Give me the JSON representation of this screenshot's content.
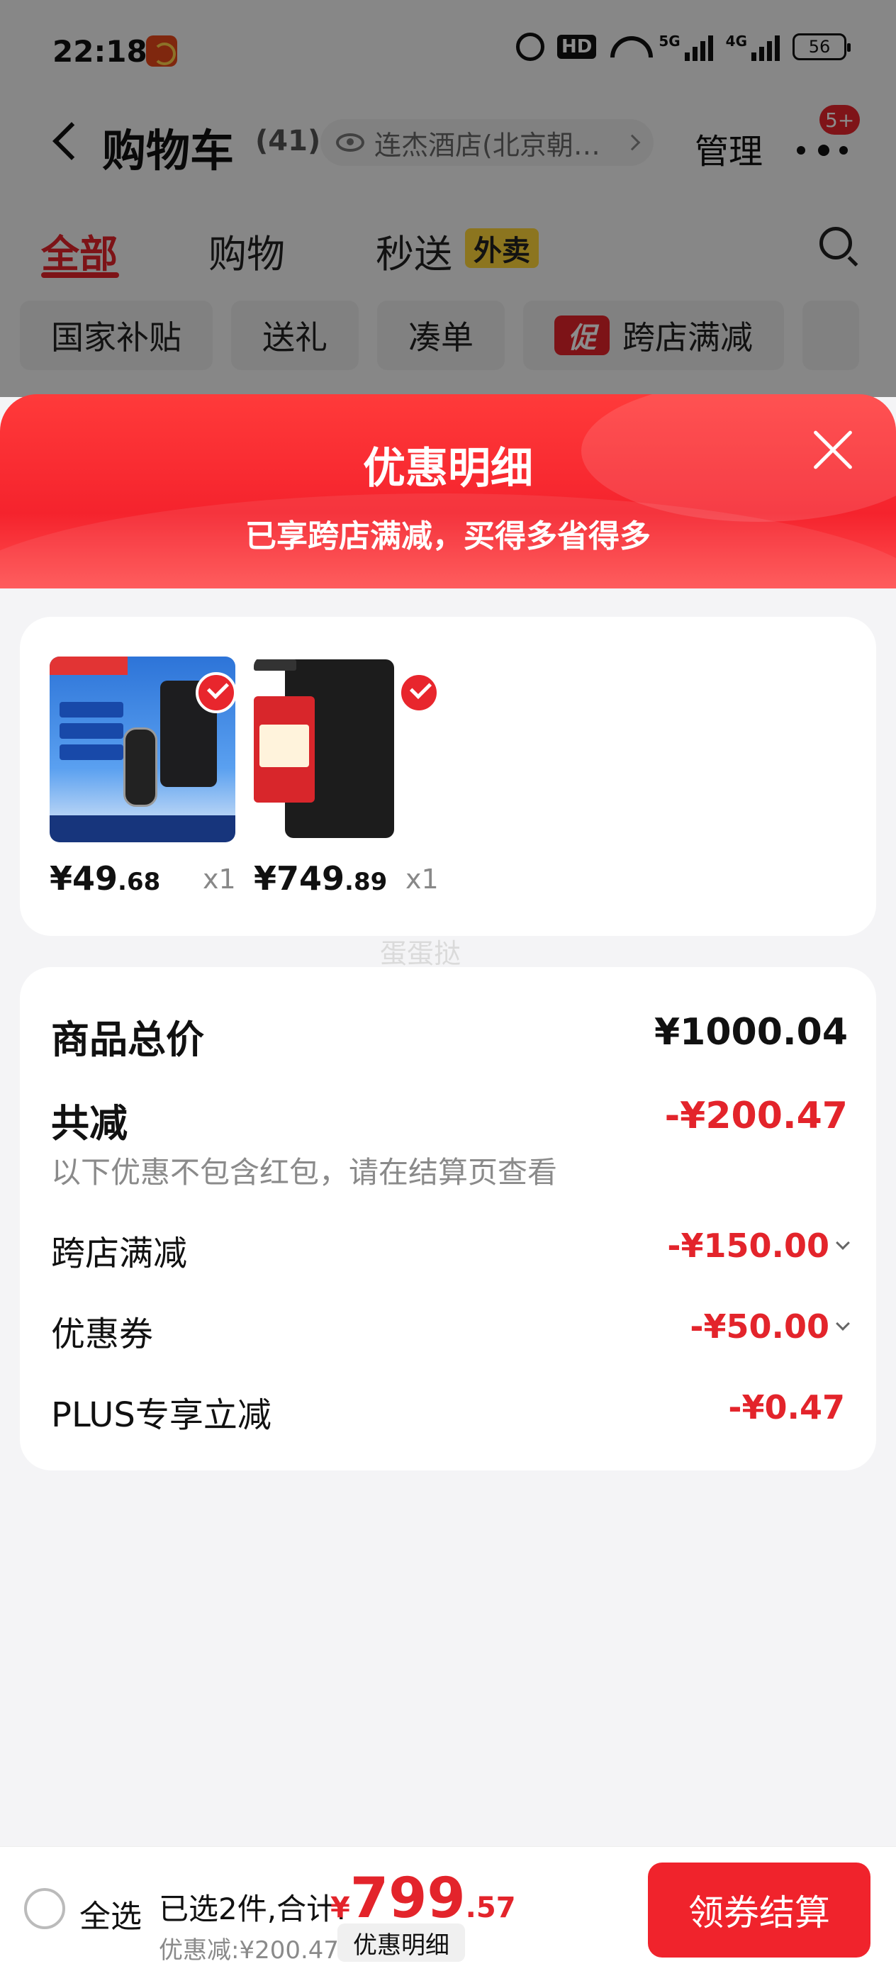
{
  "status_bar": {
    "time": "22:18",
    "hd": "HD",
    "net1": "5G",
    "net2": "4G",
    "battery": "56"
  },
  "nav": {
    "title": "购物车",
    "count": "(41)",
    "address": "连杰酒店(北京朝…",
    "manage_label": "管理",
    "badge": "5+"
  },
  "tabs": [
    {
      "label": "全部",
      "active": true
    },
    {
      "label": "购物",
      "active": false
    },
    {
      "label": "秒送",
      "active": false
    }
  ],
  "takeout_badge": "外卖",
  "chips": [
    {
      "label": "国家补贴"
    },
    {
      "label": "送礼"
    },
    {
      "label": "凑单"
    },
    {
      "label": "跨店满减",
      "tag": "促"
    }
  ],
  "sheet": {
    "title": "优惠明细",
    "subtitle": "已享跨店满减，买得多省得多"
  },
  "products": [
    {
      "price_int": "¥49",
      "price_dec": ".68",
      "qty": "x1",
      "image_icon": "door-alarm-icon",
      "checked": true
    },
    {
      "price_int": "¥749",
      "price_dec": ".89",
      "qty": "x1",
      "image_icon": "hard-drive-icon",
      "checked": true
    }
  ],
  "watermark": "蛋蛋挞",
  "summary": {
    "total_label": "商品总价",
    "total_value": "¥1000.04",
    "reduce_label": "共减",
    "reduce_value": "-¥200.47",
    "note": "以下优惠不包含红包，请在结算页查看",
    "discounts": [
      {
        "label": "跨店满减",
        "value": "-¥150.00",
        "expandable": true
      },
      {
        "label": "优惠券",
        "value": "-¥50.00",
        "expandable": true
      },
      {
        "label": "PLUS专享立减",
        "value": "-¥0.47",
        "expandable": false
      }
    ]
  },
  "bottom": {
    "select_all": "全选",
    "selected_text": "已选2件,合计:",
    "currency": "¥",
    "price_int": "799",
    "price_dec": ".57",
    "saved_text": "优惠减:¥200.47",
    "detail_label": "优惠明细",
    "checkout_label": "领券结算"
  },
  "colors": {
    "accent_red": "#e3242b",
    "header_red": "#f5232d",
    "takeout_yellow": "#ffd53a"
  }
}
